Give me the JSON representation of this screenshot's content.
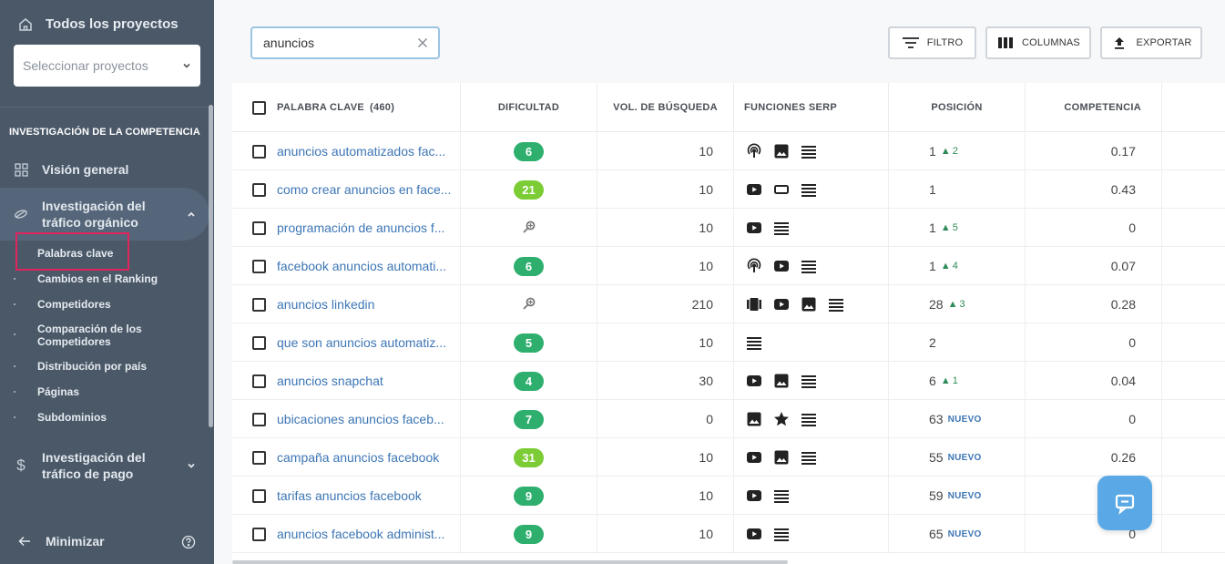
{
  "sidebar": {
    "all_projects_label": "Todos los proyectos",
    "project_select_placeholder": "Seleccionar proyectos",
    "section_title": "INVESTIGACIÓN DE LA COMPETENCIA",
    "nav": {
      "overview": "Visión general",
      "organic_line1": "Investigación del",
      "organic_line2": "tráfico orgánico",
      "paid_line1": "Investigación del",
      "paid_line2": "tráfico de pago"
    },
    "subitems": [
      {
        "label": "Palabras clave"
      },
      {
        "label": "Cambios en el Ranking"
      },
      {
        "label": "Competidores"
      },
      {
        "label_line1": "Comparación de los",
        "label_line2": "Competidores"
      },
      {
        "label": "Distribución por país"
      },
      {
        "label": "Páginas"
      },
      {
        "label": "Subdominios"
      }
    ],
    "minimize_label": "Minimizar"
  },
  "toolbar": {
    "search_value": "anuncios",
    "filter_label": "FILTRO",
    "columns_label": "COLUMNAS",
    "export_label": "EXPORTAR"
  },
  "table": {
    "headers": {
      "keyword": "PALABRA CLAVE",
      "keyword_count": "(460)",
      "difficulty": "DIFICULTAD",
      "volume": "VOL. DE BÚSQUEDA",
      "serp": "FUNCIONES SERP",
      "position": "POSICIÓN",
      "competition": "COMPETENCIA"
    },
    "rows": [
      {
        "keyword": "anuncios automatizados fac...",
        "difficulty": "6",
        "volume": "10",
        "serp": [
          "podcast-icon",
          "image-icon",
          "list-icon"
        ],
        "position": "1",
        "change": "2",
        "new": "",
        "competition": "0.17"
      },
      {
        "keyword": "como crear anuncios en face...",
        "difficulty": "21",
        "volume": "10",
        "serp": [
          "video-icon",
          "ad-box-icon",
          "list-icon"
        ],
        "position": "1",
        "change": "",
        "new": "",
        "competition": "0.43"
      },
      {
        "keyword": "programación de anuncios f...",
        "difficulty": "",
        "volume": "10",
        "serp": [
          "video-icon",
          "list-icon"
        ],
        "position": "1",
        "change": "5",
        "new": "",
        "competition": "0"
      },
      {
        "keyword": "facebook anuncios automati...",
        "difficulty": "6",
        "volume": "10",
        "serp": [
          "podcast-icon",
          "video-icon",
          "list-icon"
        ],
        "position": "1",
        "change": "4",
        "new": "",
        "competition": "0.07"
      },
      {
        "keyword": "anuncios linkedin",
        "difficulty": "",
        "volume": "210",
        "serp": [
          "carousel-icon",
          "video-icon",
          "image-icon",
          "list-icon"
        ],
        "position": "28",
        "change": "3",
        "new": "",
        "competition": "0.28"
      },
      {
        "keyword": "que son anuncios automatiz...",
        "difficulty": "5",
        "volume": "10",
        "serp": [
          "list-icon"
        ],
        "position": "2",
        "change": "",
        "new": "",
        "competition": "0"
      },
      {
        "keyword": "anuncios snapchat",
        "difficulty": "4",
        "volume": "30",
        "serp": [
          "video-icon",
          "image-icon",
          "list-icon"
        ],
        "position": "6",
        "change": "1",
        "new": "",
        "competition": "0.04"
      },
      {
        "keyword": "ubicaciones anuncios faceb...",
        "difficulty": "7",
        "volume": "0",
        "serp": [
          "image-icon",
          "star-icon",
          "list-icon"
        ],
        "position": "63",
        "change": "",
        "new": "NUEVO",
        "competition": "0"
      },
      {
        "keyword": "campaña anuncios facebook",
        "difficulty": "31",
        "volume": "10",
        "serp": [
          "video-icon",
          "image-icon",
          "list-icon"
        ],
        "position": "55",
        "change": "",
        "new": "NUEVO",
        "competition": "0.26"
      },
      {
        "keyword": "tarifas anuncios facebook",
        "difficulty": "9",
        "volume": "10",
        "serp": [
          "video-icon",
          "list-icon"
        ],
        "position": "59",
        "change": "",
        "new": "NUEVO",
        "competition": ""
      },
      {
        "keyword": "anuncios facebook administ...",
        "difficulty": "9",
        "volume": "10",
        "serp": [
          "video-icon",
          "list-icon"
        ],
        "position": "65",
        "change": "",
        "new": "NUEVO",
        "competition": "0"
      }
    ]
  },
  "colors": {
    "sidebar_bg": "#4a5868",
    "badge_green": "#2eaf6e",
    "badge_lime": "#7ccc35",
    "link": "#3d76b5",
    "highlight": "#e0245e",
    "chat": "#5aa9e6"
  }
}
